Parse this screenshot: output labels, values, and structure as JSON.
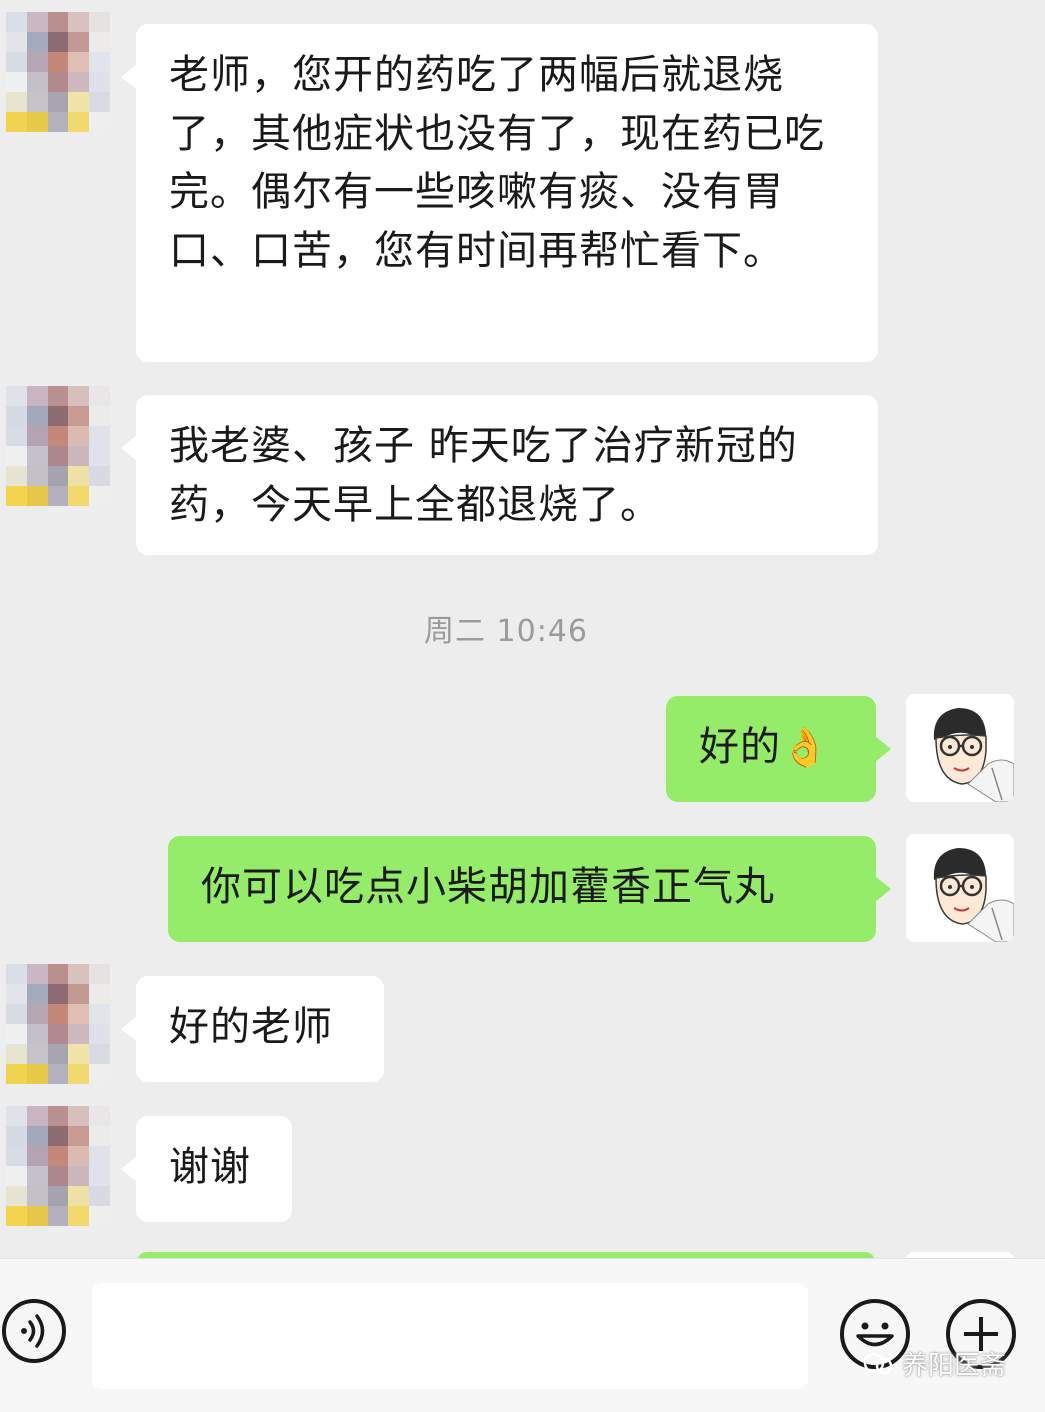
{
  "messages": [
    {
      "side": "in",
      "text": "老师，您开的药吃了两幅后就退烧了，其他症状也没有了，现在药已吃完。偶尔有一些咳嗽有痰、没有胃口、口苦，您有时间再帮忙看下。"
    },
    {
      "side": "in",
      "text": "我老婆、孩子 昨天吃了治疗新冠的药，今天早上全都退烧了。"
    },
    {
      "side": "out",
      "text": "好的",
      "emoji": "👌"
    },
    {
      "side": "out",
      "text": "你可以吃点小柴胡加藿香正气丸"
    },
    {
      "side": "in",
      "text": "好的老师"
    },
    {
      "side": "in",
      "text": "谢谢"
    }
  ],
  "timestamp": "周二 10:46",
  "input": {
    "value": "",
    "voice_icon": "voice-icon",
    "emoji_icon": "emoji-icon",
    "plus_icon": "plus-icon"
  },
  "watermark": "养阳医斋",
  "colors": {
    "background": "#ededed",
    "incoming": "#ffffff",
    "outgoing": "#95ec69"
  }
}
